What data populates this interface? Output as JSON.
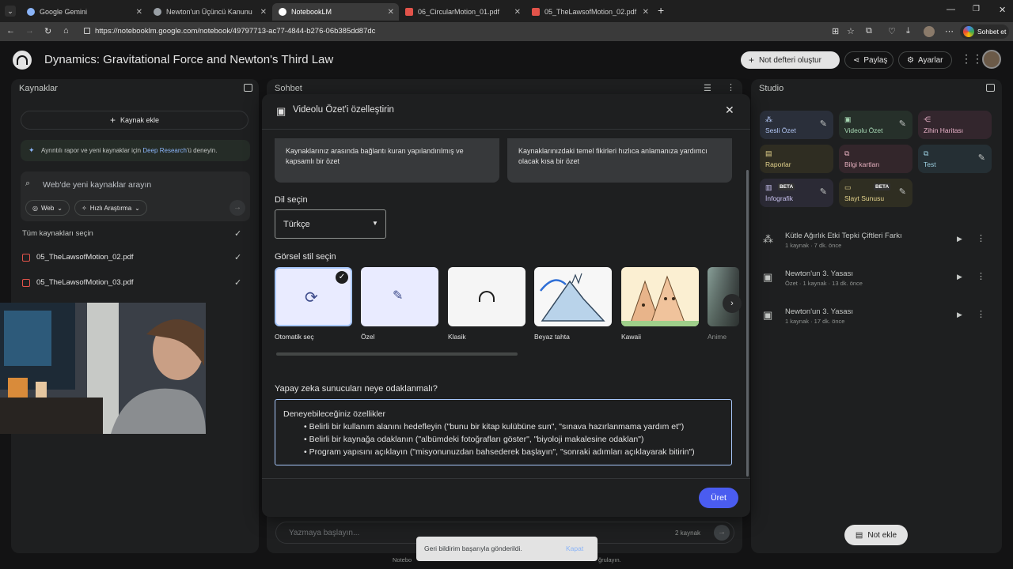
{
  "browser": {
    "tabs": [
      {
        "label": "Google Gemini",
        "active": false
      },
      {
        "label": "Newton'un Üçüncü Kanunu",
        "active": false
      },
      {
        "label": "NotebookLM",
        "active": true
      },
      {
        "label": "06_CircularMotion_01.pdf",
        "active": false
      },
      {
        "label": "05_TheLawsofMotion_02.pdf",
        "active": false
      }
    ],
    "url": "https://notebooklm.google.com/notebook/49797713-ac77-4844-b276-06b385dd87dc",
    "chat_button": "Sohbet et"
  },
  "header": {
    "title": "Dynamics: Gravitational Force and Newton's Third Law",
    "create_notebook": "Not defteri oluştur",
    "share": "Paylaş",
    "settings": "Ayarlar"
  },
  "sources": {
    "title": "Kaynaklar",
    "add_source": "Kaynak ekle",
    "promo_text": "Ayrıntılı rapor ve yeni kaynaklar için",
    "promo_link": "Deep Research",
    "promo_suffix": "'ü deneyin.",
    "search_placeholder": "Web'de yeni kaynaklar arayın",
    "web_chip": "Web",
    "research_chip": "Hızlı Araştırma",
    "select_all": "Tüm kaynakları seçin",
    "files": [
      {
        "name": "05_TheLawsofMotion_02.pdf",
        "checked": true
      },
      {
        "name": "05_TheLawsofMotion_03.pdf",
        "checked": true
      }
    ]
  },
  "chat": {
    "title": "Sohbet",
    "input_placeholder": "Yazmaya başlayın...",
    "source_count": "2 kaynak",
    "footer_prefix": "Notebo",
    "footer_suffix": "ğrulayın."
  },
  "modal": {
    "title": "Videolu Özet'i özelleştirin",
    "format_options": [
      {
        "text": "Kaynaklarınız arasında bağlantı kuran yapılandırılmış ve kapsamlı bir özet"
      },
      {
        "text": "Kaynaklarınızdaki temel fikirleri hızlıca anlamanıza yardımcı olacak kısa bir özet"
      }
    ],
    "language_label": "Dil seçin",
    "language_value": "Türkçe",
    "style_label": "Görsel stil seçin",
    "styles": [
      {
        "label": "Otomatik seç",
        "selected": true
      },
      {
        "label": "Özel",
        "selected": false
      },
      {
        "label": "Klasik",
        "selected": false
      },
      {
        "label": "Beyaz tahta",
        "selected": false
      },
      {
        "label": "Kawaii",
        "selected": false
      },
      {
        "label": "Anime",
        "selected": false
      }
    ],
    "focus_label": "Yapay zeka sunucuları neye odaklanmalı?",
    "focus_heading": "Deneyebileceğiniz özellikler",
    "focus_items": [
      "Belirli bir kullanım alanını hedefleyin (\"bunu bir kitap kulübüne sun\", \"sınava hazırlanmama yardım et\")",
      "Belirli bir kaynağa odaklanın (\"albümdeki fotoğrafları göster\", \"biyoloji makalesine odaklan\")",
      "Program yapısını açıklayın (\"misyonunuzdan bahsederek başlayın\", \"sonraki adımları açıklayarak bitirin\")"
    ],
    "generate_button": "Üret"
  },
  "studio": {
    "title": "Studio",
    "tiles": [
      {
        "label": "Sesli Özet",
        "color": "#2a2f3a",
        "accent": "#b3c7f5"
      },
      {
        "label": "Videolu Özet",
        "color": "#26302a",
        "accent": "#a7d8b4"
      },
      {
        "label": "Zihin Haritası",
        "color": "#33262d",
        "accent": "#e8b1c8"
      },
      {
        "label": "Raporlar",
        "color": "#2f2d22",
        "accent": "#e5d48d"
      },
      {
        "label": "Bilgi kartları",
        "color": "#33262b",
        "accent": "#e8b1c0"
      },
      {
        "label": "Test",
        "color": "#252f34",
        "accent": "#9ccfe0"
      },
      {
        "label": "İnfografik",
        "color": "#2b2a35",
        "accent": "#c9c2f0",
        "badge": "BETA"
      },
      {
        "label": "Slayt Sunusu",
        "color": "#2f2e22",
        "accent": "#e5d48d",
        "badge": "BETA"
      }
    ],
    "artifacts": [
      {
        "title": "Kütle Ağırlık Etki Tepki Çiftleri Farkı",
        "meta": "1 kaynak · 7 dk. önce"
      },
      {
        "title": "Newton'un 3. Yasası",
        "meta": "Özet · 1 kaynak · 13 dk. önce"
      },
      {
        "title": "Newton'un 3. Yasası",
        "meta": "1 kaynak · 17 dk. önce"
      }
    ],
    "add_note": "Not ekle"
  },
  "toast": {
    "message": "Geri bildirim başarıyla gönderildi.",
    "action": "Kapat"
  }
}
